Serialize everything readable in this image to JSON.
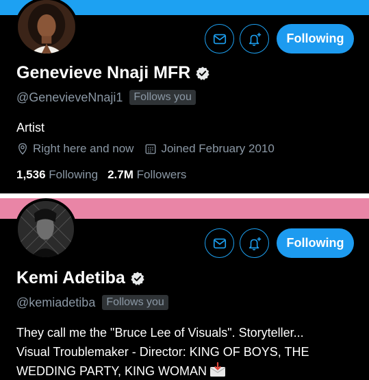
{
  "colors": {
    "banner_blue": "#1da1f2",
    "banner_pink": "#e985a6",
    "accent": "#1d9bf0",
    "muted_text": "#8b98a5",
    "background": "#000000"
  },
  "profiles": [
    {
      "display_name": "Genevieve Nnaji MFR",
      "handle": "@GenevieveNnaji1",
      "follows_you": "Follows you",
      "bio_lines": [
        "Artist"
      ],
      "location": "Right here and now",
      "joined": "Joined February 2010",
      "following_count": "1,536",
      "following_label": "Following",
      "followers_count": "2.7M",
      "followers_label": "Followers",
      "follow_button_label": "Following",
      "icons": [
        "mail-icon",
        "bell-plus-icon",
        "verified-badge-icon",
        "location-pin-icon",
        "calendar-icon"
      ]
    },
    {
      "display_name": "Kemi Adetiba",
      "handle": "@kemiadetiba",
      "follows_you": "Follows you",
      "bio_lines": [
        "They call me the \"Bruce Lee of Visuals\". Storyteller...",
        "Visual Troublemaker - Director: KING OF BOYS, THE",
        "WEDDING PARTY, KING WOMAN"
      ],
      "follow_button_label": "Following",
      "icons": [
        "mail-icon",
        "bell-plus-icon",
        "verified-badge-icon",
        "envelope-arrow-emoji-icon"
      ]
    }
  ]
}
